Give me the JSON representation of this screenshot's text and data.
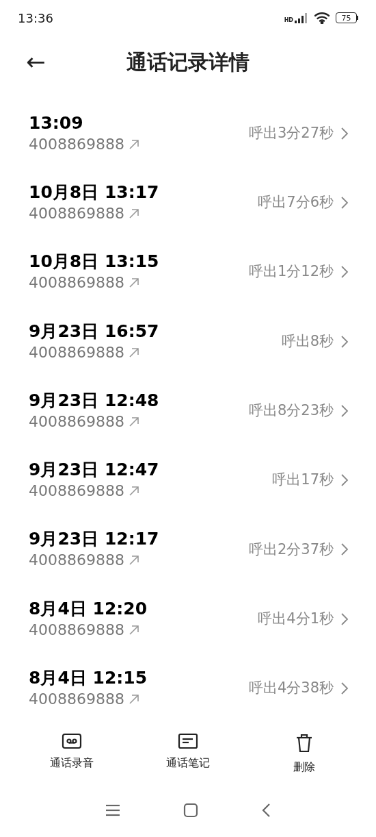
{
  "status_bar": {
    "time": "13:36",
    "network": "HD",
    "battery": "75"
  },
  "header": {
    "back": "←",
    "title": "通话记录详情"
  },
  "calls": [
    {
      "time": "13:09",
      "number": "4008869888",
      "detail": "呼出3分27秒"
    },
    {
      "time": "10月8日 13:17",
      "number": "4008869888",
      "detail": "呼出7分6秒"
    },
    {
      "time": "10月8日 13:15",
      "number": "4008869888",
      "detail": "呼出1分12秒"
    },
    {
      "time": "9月23日 16:57",
      "number": "4008869888",
      "detail": "呼出8秒"
    },
    {
      "time": "9月23日 12:48",
      "number": "4008869888",
      "detail": "呼出8分23秒"
    },
    {
      "time": "9月23日 12:47",
      "number": "4008869888",
      "detail": "呼出17秒"
    },
    {
      "time": "9月23日 12:17",
      "number": "4008869888",
      "detail": "呼出2分37秒"
    },
    {
      "time": "8月4日 12:20",
      "number": "4008869888",
      "detail": "呼出4分1秒"
    },
    {
      "time": "8月4日 12:15",
      "number": "4008869888",
      "detail": "呼出4分38秒"
    }
  ],
  "actions": [
    {
      "kind": "recording",
      "label": "通话录音"
    },
    {
      "kind": "notes",
      "label": "通话笔记"
    },
    {
      "kind": "delete",
      "label": "删除"
    }
  ]
}
